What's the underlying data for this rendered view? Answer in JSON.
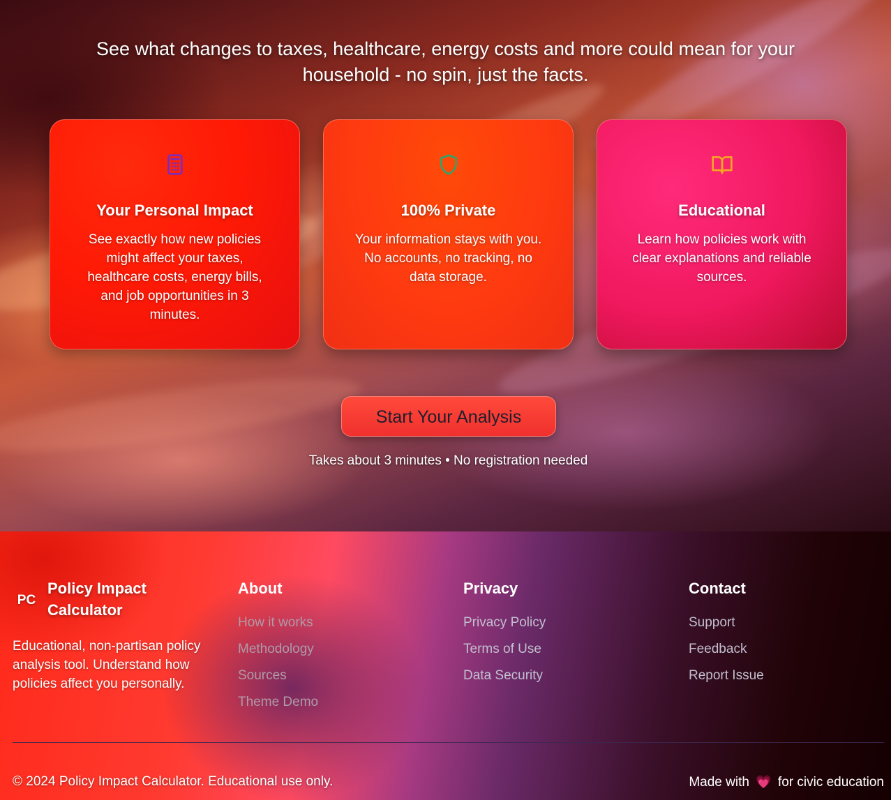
{
  "hero": {
    "subtitle": "See what changes to taxes, healthcare, energy costs and more could mean for your household - no spin, just the facts."
  },
  "features": [
    {
      "icon": "calculator-icon",
      "icon_color": "#7b2cbf",
      "title": "Your Personal Impact",
      "description": "See exactly how new policies might affect your taxes, healthcare costs, energy bills, and job opportunities in 3 minutes."
    },
    {
      "icon": "shield-icon",
      "icon_color": "#2ea56a",
      "title": "100% Private",
      "description": "Your information stays with you. No accounts, no tracking, no data storage."
    },
    {
      "icon": "book-icon",
      "icon_color": "#f5a524",
      "title": "Educational",
      "description": "Learn how policies work with clear explanations and reliable sources."
    }
  ],
  "cta": {
    "label": "Start Your Analysis",
    "note": "Takes about 3 minutes • No registration needed"
  },
  "footer": {
    "logo_initials": "PC",
    "brand_name": "Policy Impact Calculator",
    "tagline": "Educational, non-partisan policy analysis tool. Understand how policies affect you personally.",
    "about": {
      "heading": "About",
      "links": [
        "How it works",
        "Methodology",
        "Sources",
        "Theme Demo"
      ]
    },
    "privacy": {
      "heading": "Privacy",
      "links": [
        "Privacy Policy",
        "Terms of Use",
        "Data Security"
      ]
    },
    "contact": {
      "heading": "Contact",
      "links": [
        "Support",
        "Feedback",
        "Report Issue"
      ]
    },
    "copyright": "© 2024 Policy Impact Calculator. Educational use only.",
    "made_with_prefix": "Made with",
    "made_with_suffix": "for civic education"
  }
}
